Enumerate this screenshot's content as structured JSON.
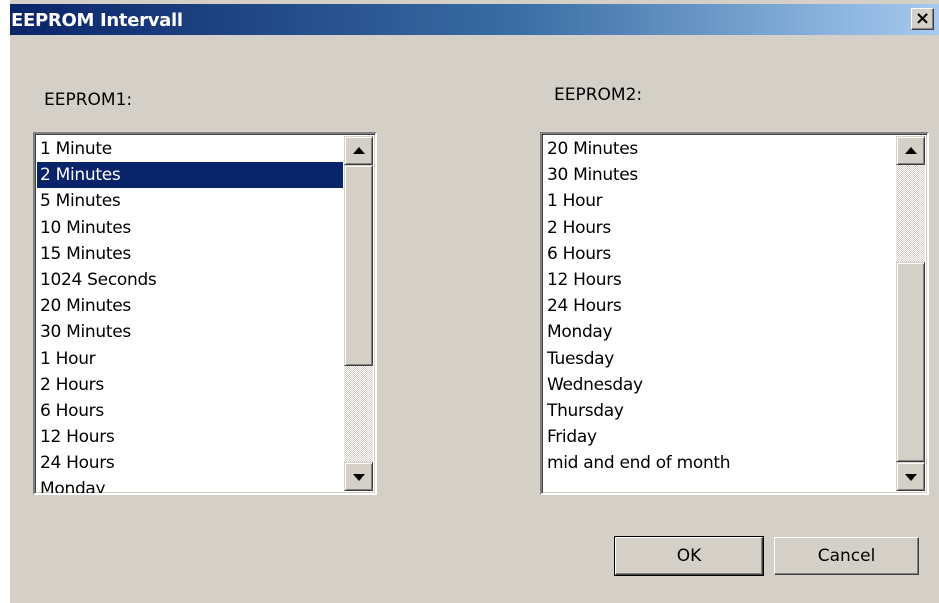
{
  "window": {
    "title": "EEPROM Intervall",
    "close_label": "×"
  },
  "eeprom1": {
    "label": "EEPROM1:",
    "items": [
      "1 Minute",
      "2  Minutes",
      "5  Minutes",
      "10  Minutes",
      "15  Minutes",
      "1024 Seconds",
      "20  Minutes",
      "30  Minutes",
      "1 Hour",
      "2  Hours",
      "6  Hours",
      "12  Hours",
      "24  Hours",
      "Monday"
    ],
    "selected": "2  Minutes"
  },
  "eeprom2": {
    "label": "EEPROM2:",
    "items": [
      "20  Minutes",
      "30  Minutes",
      "1 Hour",
      "2  Hours",
      "6  Hours",
      "12  Hours",
      "24  Hours",
      "Monday",
      "Tuesday",
      "Wednesday",
      "Thursday",
      "Friday",
      "mid and end of month"
    ]
  },
  "buttons": {
    "ok": "OK",
    "cancel": "Cancel"
  },
  "colors": {
    "title_start": "#0a246a",
    "title_end": "#a6caf0",
    "selection": "#0a246a",
    "face": "#d4d0c8"
  },
  "icons": {
    "close": "close-icon",
    "up": "scroll-up-arrow-icon",
    "down": "scroll-down-arrow-icon"
  }
}
